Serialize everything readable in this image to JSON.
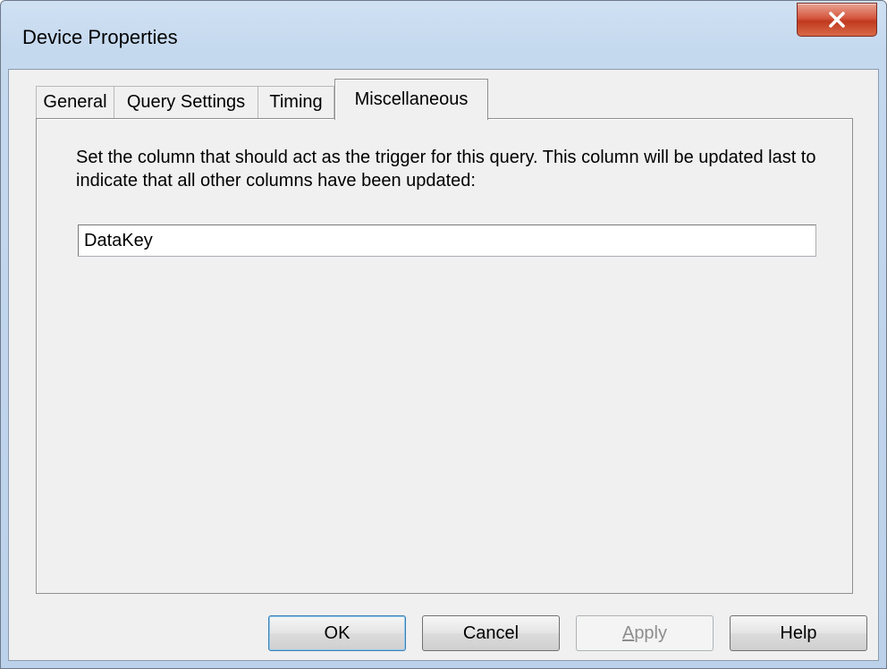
{
  "window": {
    "title": "Device Properties"
  },
  "tabs": [
    {
      "label": "General",
      "active": false
    },
    {
      "label": "Query Settings",
      "active": false
    },
    {
      "label": "Timing",
      "active": false
    },
    {
      "label": "Miscellaneous",
      "active": true
    }
  ],
  "panel": {
    "instruction": "Set the column that should act as the trigger for this query.  This column will be updated last to indicate that all other columns have been updated:",
    "trigger_value": "DataKey"
  },
  "buttons": {
    "ok": "OK",
    "cancel": "Cancel",
    "apply_first": "A",
    "apply_rest": "pply",
    "help": "Help"
  },
  "colors": {
    "close_button": "#c9452c",
    "dialog_face": "#f0f0f0"
  }
}
